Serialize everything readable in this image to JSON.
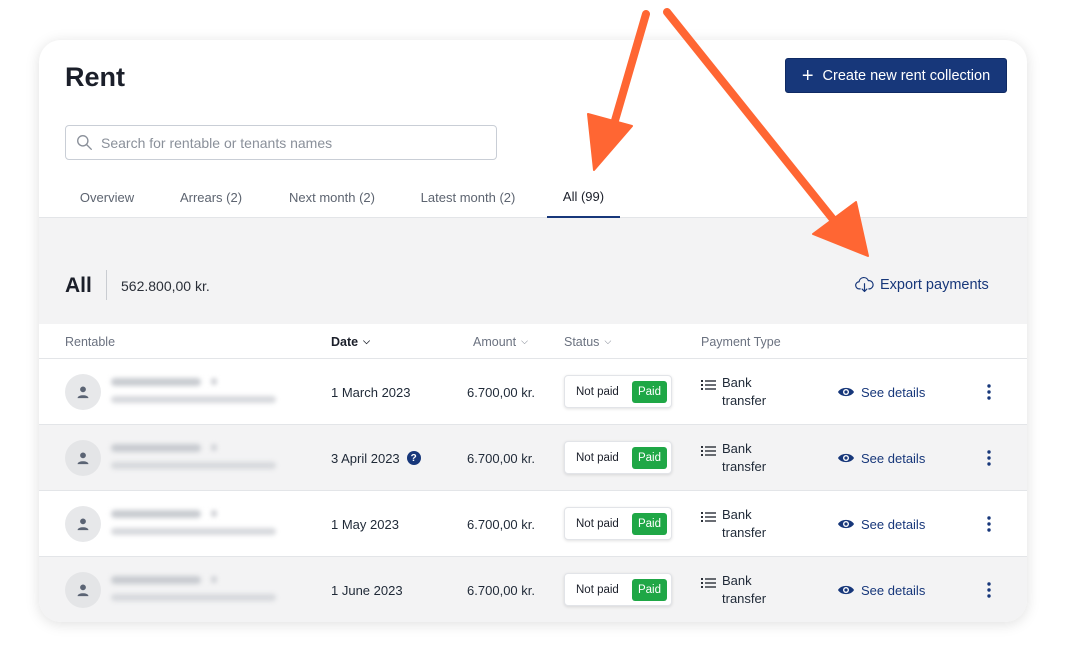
{
  "header": {
    "title": "Rent",
    "create_button_label": "Create new rent collection",
    "create_button_icon": "plus-icon"
  },
  "search": {
    "placeholder": "Search for rentable or tenants names",
    "value": ""
  },
  "tabs": [
    {
      "label": "Overview",
      "active": false
    },
    {
      "label": "Arrears (2)",
      "active": false
    },
    {
      "label": "Next month (2)",
      "active": false
    },
    {
      "label": "Latest month (2)",
      "active": false
    },
    {
      "label": "All (99)",
      "active": true
    }
  ],
  "summary": {
    "title": "All",
    "total": "562.800,00 kr.",
    "export_label": "Export payments",
    "export_icon": "cloud-download-icon"
  },
  "table": {
    "columns": {
      "rentable": "Rentable",
      "date": "Date",
      "amount": "Amount",
      "status": "Status",
      "payment_type": "Payment Type"
    },
    "rows": [
      {
        "date": "1 March 2023",
        "has_info": false,
        "amount": "6.700,00 kr.",
        "status_not_paid": "Not paid",
        "status_paid": "Paid",
        "ptype_line1": "Bank",
        "ptype_line2": "transfer",
        "details": "See details"
      },
      {
        "date": "3 April 2023",
        "has_info": true,
        "info_symbol": "?",
        "amount": "6.700,00 kr.",
        "status_not_paid": "Not paid",
        "status_paid": "Paid",
        "ptype_line1": "Bank",
        "ptype_line2": "transfer",
        "details": "See details"
      },
      {
        "date": "1 May 2023",
        "has_info": false,
        "amount": "6.700,00 kr.",
        "status_not_paid": "Not paid",
        "status_paid": "Paid",
        "ptype_line1": "Bank",
        "ptype_line2": "transfer",
        "details": "See details"
      },
      {
        "date": "1 June 2023",
        "has_info": false,
        "amount": "6.700,00 kr.",
        "status_not_paid": "Not paid",
        "status_paid": "Paid",
        "ptype_line1": "Bank",
        "ptype_line2": "transfer",
        "details": "See details"
      }
    ]
  },
  "colors": {
    "primary": "#17377a",
    "paid_green": "#1fa746",
    "annotation_arrow": "#ff6633"
  }
}
